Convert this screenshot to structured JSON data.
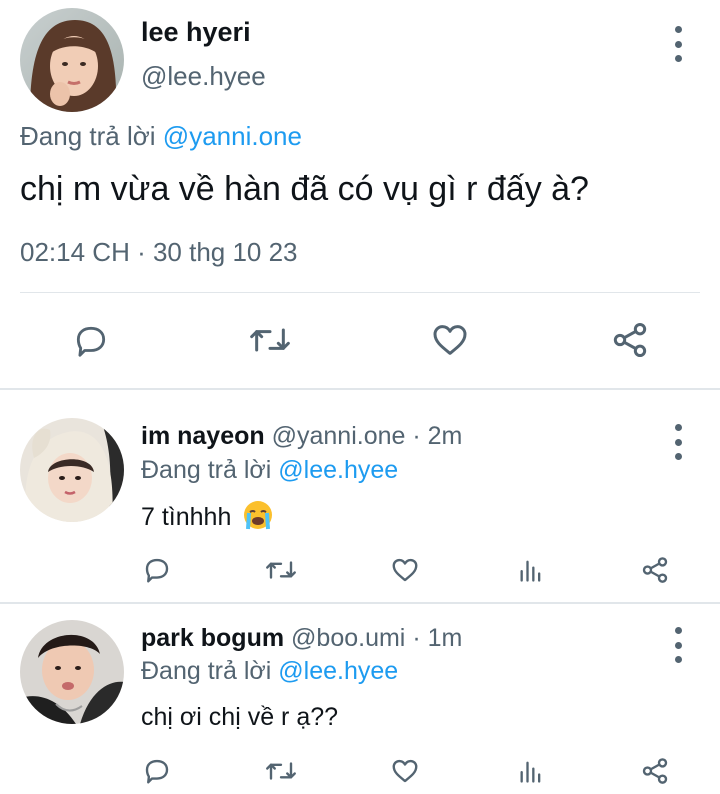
{
  "main_tweet": {
    "display_name": "lee hyeri",
    "handle": "@lee.hyee",
    "replying_prefix": "Đang trả lời",
    "replying_to": "@yanni.one",
    "text": "chị m vừa về hàn đã có vụ gì r đấy à?",
    "timestamp": "02:14 CH · 30 thg 10 23",
    "actions": [
      "reply-icon",
      "retweet-icon",
      "like-icon",
      "share-icon"
    ]
  },
  "replies": [
    {
      "display_name": "im nayeon",
      "handle": "@yanni.one",
      "time_ago": "· 2m",
      "replying_prefix": "Đang trả lời",
      "replying_to": "@lee.hyee",
      "text": "7 tìnhhh",
      "emoji": "😭"
    },
    {
      "display_name": "park bogum",
      "handle": "@boo.umi",
      "time_ago": "· 1m",
      "replying_prefix": "Đang trả lời",
      "replying_to": "@lee.hyee",
      "text": "chị ơi chị về r ạ??"
    }
  ],
  "colors": {
    "link": "#1d9bf0",
    "muted": "#536471",
    "divider": "#e1e6ea"
  }
}
